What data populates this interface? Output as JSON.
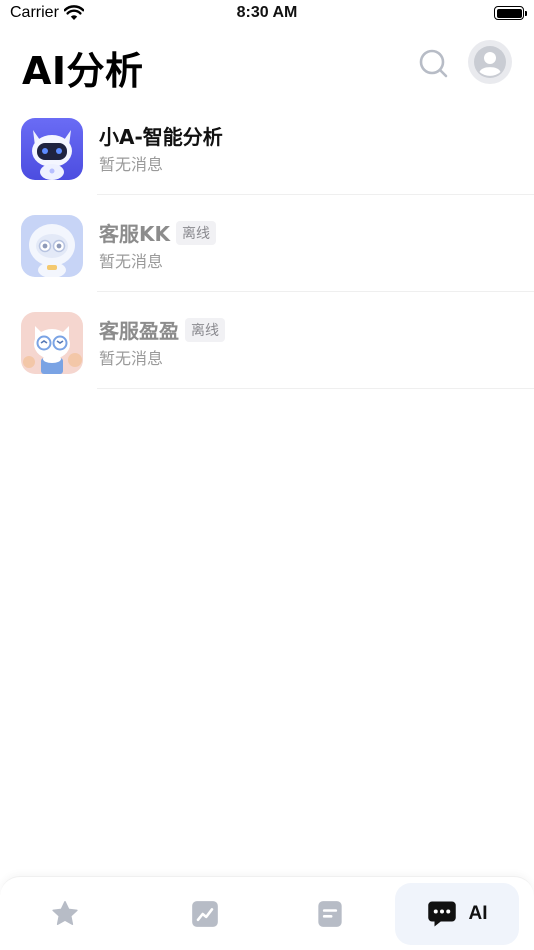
{
  "status_bar": {
    "carrier": "Carrier",
    "time": "8:30 AM"
  },
  "header": {
    "title": "AI分析"
  },
  "conversations": [
    {
      "name": "小A-智能分析",
      "preview": "暂无消息",
      "badge": ""
    },
    {
      "name": "客服KK",
      "preview": "暂无消息",
      "badge": "离线"
    },
    {
      "name": "客服盈盈",
      "preview": "暂无消息",
      "badge": "离线"
    }
  ],
  "tabbar": {
    "active_label": "AI"
  },
  "colors": {
    "accent_blue": "#5b5cf0",
    "icon_gray": "#b7bcc6",
    "badge_bg": "#f1f1f4"
  }
}
